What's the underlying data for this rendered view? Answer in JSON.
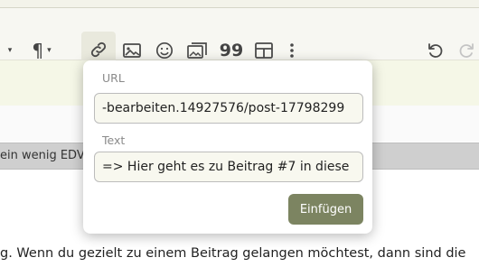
{
  "toolbar": {
    "paragraph_glyph": "¶",
    "image_gallery_glyph": "99"
  },
  "popup": {
    "url_label": "URL",
    "url_value": "-bearbeiten.14927576/post-17798299",
    "text_label": "Text",
    "text_value": "=> Hier geht es zu Beitrag #7 in diese",
    "insert_label": "Einfügen"
  },
  "background": {
    "gray_bar_text": "ein wenig EDV",
    "body_text": "g. Wenn du gezielt zu einem Beitrag gelangen möchtest, dann sind die"
  },
  "colors": {
    "accent_button": "#7c8461",
    "field_background": "#f8f8ef",
    "editor_background": "#f5f7e7"
  }
}
